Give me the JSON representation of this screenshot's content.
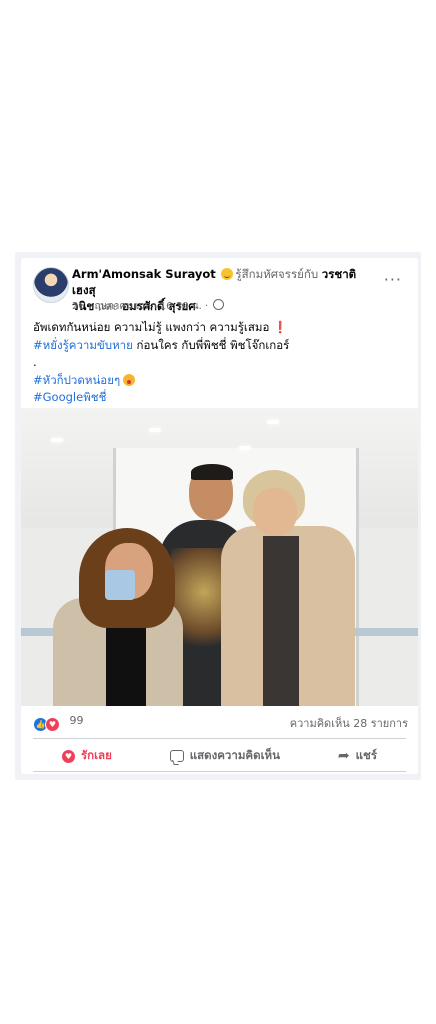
{
  "post": {
    "author": "Arm'Amonsak Surayot",
    "feeling_text": "รู้สึกมหัศจรรย์กับ",
    "tagged1_line1": "วรชาติ เฮงสุ",
    "tagged1_line2": "วนิช",
    "connector": "และ",
    "tagged2": "อมรศักดิ์ สุรยศ",
    "date": "26 พฤษภาคม เวลา 16:30 น. ·",
    "more": "···",
    "line1": "อัพเดทกันหน่อย ความไม่รู้ แพงกว่า ความรู้เสมอ",
    "line1_mark": "❗",
    "line2_tag": "#หยั่งรู้ความขับหาย",
    "line2_rest": " ก่อนใคร กับพี่พิชชี่  พิชโจ๊กเกอร์",
    "line3": ".",
    "line4_tag": "#หัวก็ปวดหน่อยๆ",
    "line5_tag": "#Googleพิชชี่"
  },
  "reactions": {
    "like_icon": "👍",
    "love_icon": "♥",
    "count": "99",
    "comments": "ความคิดเห็น 28 รายการ"
  },
  "actions": {
    "love": "รักเลย",
    "comment": "แสดงความคิดเห็น",
    "share": "แชร์",
    "share_icon": "➦",
    "heart_icon": "♥"
  },
  "colors": {
    "link": "#216fdb",
    "love": "#f33e58",
    "like": "#1b74e4"
  }
}
